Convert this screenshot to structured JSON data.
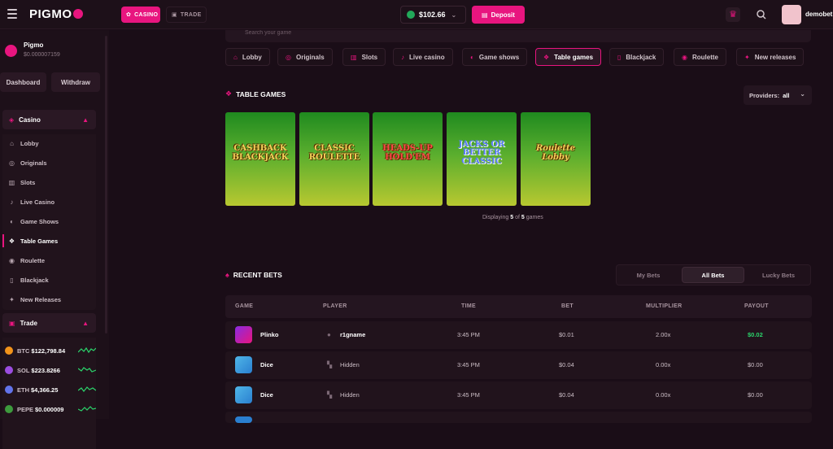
{
  "header": {
    "logo_text": "PIGMO",
    "nav": [
      {
        "label": "CASINO",
        "icon": "casino-chip-icon"
      },
      {
        "label": "TRADE",
        "icon": "trade-icon"
      }
    ],
    "balance": "$102.66",
    "deposit_label": "Deposit",
    "username": "demobet"
  },
  "sidebar": {
    "user_name": "Pigmo",
    "user_balance": "$0.000007159",
    "buttons": [
      "Dashboard",
      "Withdraw"
    ],
    "casino_label": "Casino",
    "casino_items": [
      {
        "label": "Lobby",
        "icon": "home-icon"
      },
      {
        "label": "Originals",
        "icon": "originals-icon"
      },
      {
        "label": "Slots",
        "icon": "slots-icon"
      },
      {
        "label": "Live Casino",
        "icon": "microphone-icon"
      },
      {
        "label": "Game Shows",
        "icon": "game-shows-icon"
      },
      {
        "label": "Table Games",
        "icon": "table-games-icon"
      },
      {
        "label": "Roulette",
        "icon": "roulette-icon"
      },
      {
        "label": "Blackjack",
        "icon": "cards-icon"
      },
      {
        "label": "New Releases",
        "icon": "new-releases-icon"
      }
    ],
    "active_item": "Table Games",
    "trade_label": "Trade",
    "tickers": [
      {
        "symbol": "BTC",
        "price": "$122,798.84",
        "color": "#f2931a"
      },
      {
        "symbol": "SOL",
        "price": "$223.8266",
        "color": "#9b4de0"
      },
      {
        "symbol": "ETH",
        "price": "$4,366.25",
        "color": "#6273ea"
      },
      {
        "symbol": "PEPE",
        "price": "$0.000009",
        "color": "#3d9a3d"
      }
    ]
  },
  "main": {
    "search_placeholder": "Search your game",
    "categories": [
      {
        "label": "Lobby",
        "icon": "home-icon"
      },
      {
        "label": "Originals",
        "icon": "originals-icon"
      },
      {
        "label": "Slots",
        "icon": "slots-icon"
      },
      {
        "label": "Live casino",
        "icon": "microphone-icon"
      },
      {
        "label": "Game shows",
        "icon": "game-shows-icon"
      },
      {
        "label": "Table games",
        "icon": "table-games-icon"
      },
      {
        "label": "Blackjack",
        "icon": "cards-icon"
      },
      {
        "label": "Roulette",
        "icon": "roulette-icon"
      },
      {
        "label": "New releases",
        "icon": "new-releases-icon"
      }
    ],
    "active_category": "Table games",
    "section_title": "TABLE GAMES",
    "providers_label": "Providers:",
    "providers_value": "all",
    "games": [
      {
        "title": "CASHBACK BLACKJACK"
      },
      {
        "title": "CLASSIC ROULETTE"
      },
      {
        "title": "HEADS-UP HOLD'EM"
      },
      {
        "title": "JACKS OR BETTER CLASSIC"
      },
      {
        "title": "Roulette Lobby"
      }
    ],
    "displaying_prefix": "Displaying",
    "displaying_count": "5",
    "displaying_of": "of",
    "displaying_total": "5",
    "displaying_suffix": "games",
    "recent_bets_title": "RECENT BETS",
    "bet_tabs": [
      "My Bets",
      "All Bets",
      "Lucky Bets"
    ],
    "active_bet_tab": "All Bets",
    "table": {
      "columns": [
        "GAME",
        "PLAYER",
        "TIME",
        "BET",
        "MULTIPLIER",
        "PAYOUT"
      ],
      "rows": [
        {
          "game": "Plinko",
          "player": "r1gname",
          "time": "3:45 PM",
          "bet": "$0.01",
          "multiplier": "2.00x",
          "payout": "$0.02",
          "win": true
        },
        {
          "game": "Dice",
          "player": "Hidden",
          "time": "3:45 PM",
          "bet": "$0.04",
          "multiplier": "0.00x",
          "payout": "$0.00",
          "win": false
        },
        {
          "game": "Dice",
          "player": "Hidden",
          "time": "3:45 PM",
          "bet": "$0.04",
          "multiplier": "0.00x",
          "payout": "$0.00",
          "win": false
        }
      ]
    }
  }
}
